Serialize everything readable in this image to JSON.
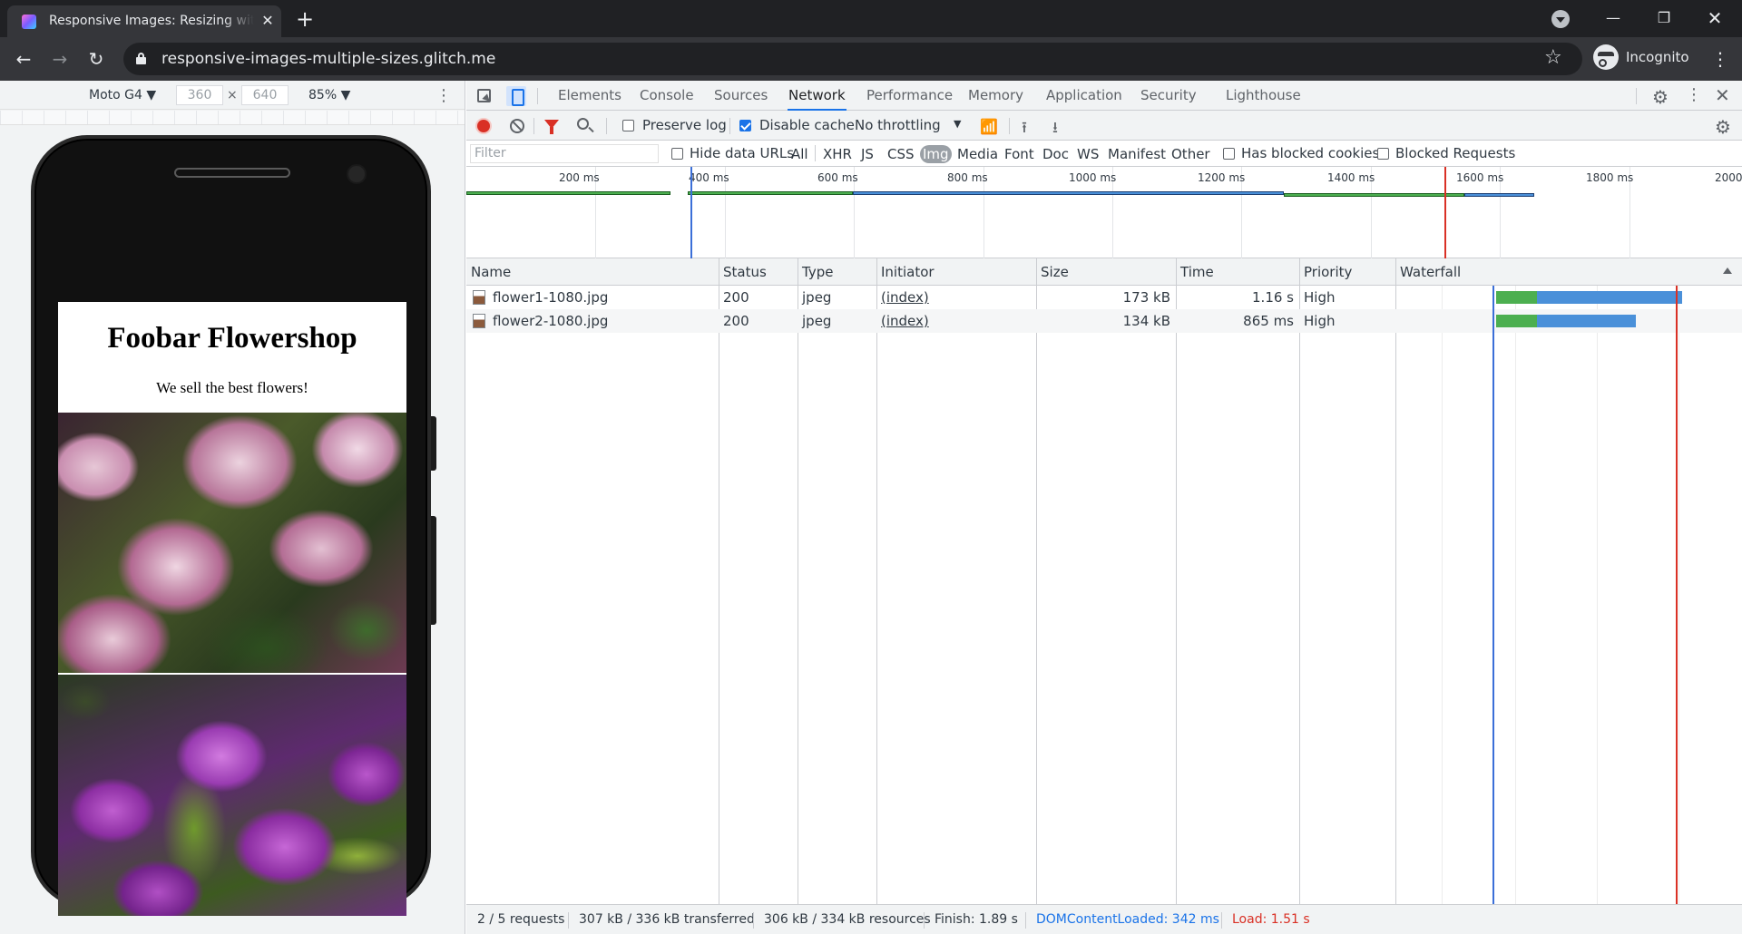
{
  "browser": {
    "tab_title": "Responsive Images: Resizing with",
    "tab_close_glyph": "✕",
    "new_tab_glyph": "+",
    "url": "responsive-images-multiple-sizes.glitch.me",
    "profile_label": "Incognito",
    "icons": [
      "back-arrow-icon",
      "forward-arrow-icon",
      "reload-icon",
      "lock-icon",
      "star-icon",
      "incognito-icon",
      "more-vert-icon",
      "tab-search-icon",
      "minimize-icon",
      "maximize-icon",
      "close-icon"
    ]
  },
  "device_toolbar": {
    "device": "Moto G4 ▼",
    "width": "360",
    "times": "×",
    "height": "640",
    "zoom": "85% ▼"
  },
  "site": {
    "title": "Foobar Flowershop",
    "subtitle": "We sell the best flowers!"
  },
  "devtools": {
    "tabs": [
      "Elements",
      "Console",
      "Sources",
      "Network",
      "Performance",
      "Memory",
      "Application",
      "Security",
      "Lighthouse"
    ],
    "active_tab": "Network",
    "toolbar": {
      "preserve_log": "Preserve log",
      "preserve_log_checked": false,
      "disable_cache": "Disable cache",
      "disable_cache_checked": true,
      "throttling": "No throttling"
    },
    "filter": {
      "placeholder": "Filter",
      "hide_data_urls": "Hide data URLs",
      "types": [
        "All",
        "XHR",
        "JS",
        "CSS",
        "Img",
        "Media",
        "Font",
        "Doc",
        "WS",
        "Manifest",
        "Other"
      ],
      "active_type": "Img",
      "has_blocked_cookies": "Has blocked cookies",
      "blocked_requests": "Blocked Requests"
    },
    "overview": {
      "ticks": [
        "200 ms",
        "400 ms",
        "600 ms",
        "800 ms",
        "1000 ms",
        "1200 ms",
        "1400 ms",
        "1600 ms",
        "1800 ms",
        "2000"
      ]
    },
    "columns": [
      "Name",
      "Status",
      "Type",
      "Initiator",
      "Size",
      "Time",
      "Priority",
      "Waterfall"
    ],
    "requests": [
      {
        "name": "flower1-1080.jpg",
        "status": "200",
        "type": "jpeg",
        "initiator": "(index)",
        "size": "173 kB",
        "time": "1.16 s",
        "priority": "High"
      },
      {
        "name": "flower2-1080.jpg",
        "status": "200",
        "type": "jpeg",
        "initiator": "(index)",
        "size": "134 kB",
        "time": "865 ms",
        "priority": "High"
      }
    ],
    "summary": {
      "requests": "2 / 5 requests",
      "transferred": "307 kB / 336 kB transferred",
      "resources": "306 kB / 334 kB resources",
      "finish": "Finish: 1.89 s",
      "dom_content_loaded": "DOMContentLoaded: 342 ms",
      "load": "Load: 1.51 s"
    },
    "colors": {
      "accent": "#1a73e8",
      "waiting": "#4caf50",
      "download": "#4a90d9",
      "dcl_line": "#3b6fd8",
      "load_line": "#d93025"
    }
  }
}
